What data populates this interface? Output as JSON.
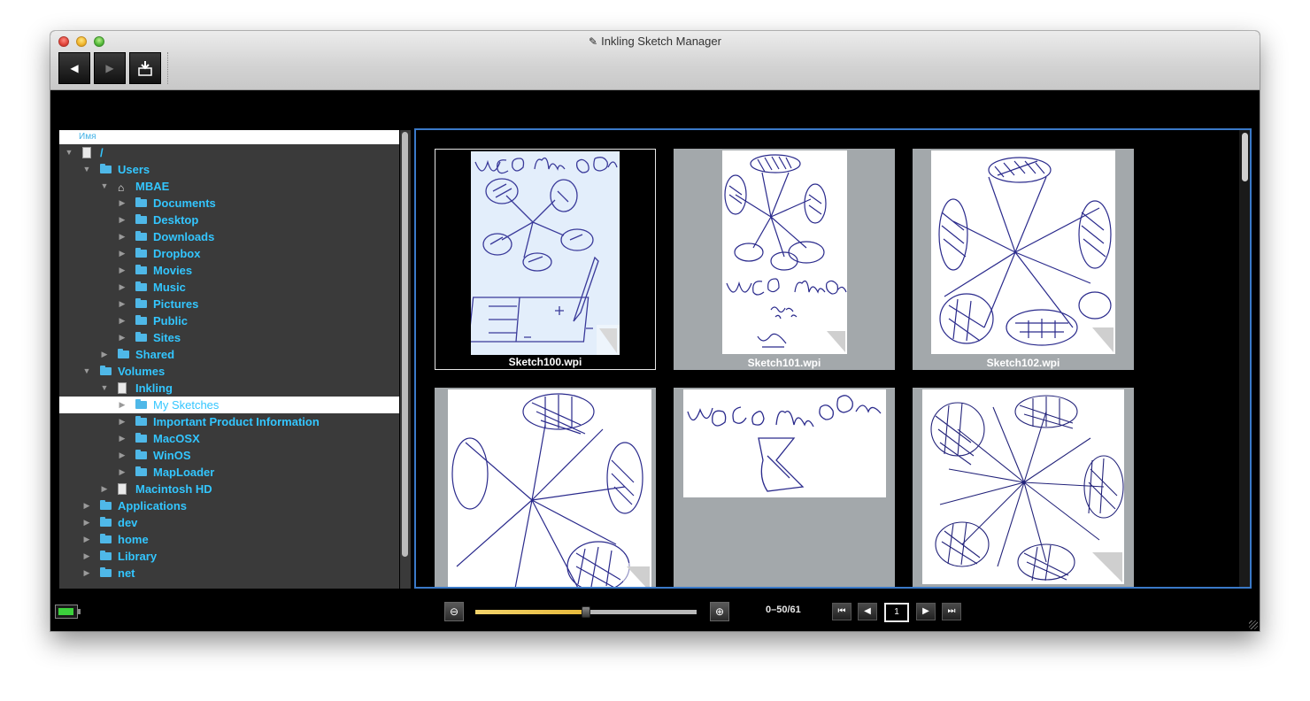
{
  "window": {
    "title": "Inkling Sketch Manager"
  },
  "toolbar": {
    "back_icon": "◀",
    "forward_icon": "▶",
    "export_icon": "⎙"
  },
  "tree": {
    "column_header": "Имя",
    "items": [
      {
        "label": "/",
        "depth": 0,
        "expanded": true,
        "icon": "disk"
      },
      {
        "label": "Users",
        "depth": 1,
        "expanded": true,
        "icon": "folder"
      },
      {
        "label": "MBAE",
        "depth": 2,
        "expanded": true,
        "icon": "home"
      },
      {
        "label": "Documents",
        "depth": 3,
        "expanded": false,
        "icon": "folder"
      },
      {
        "label": "Desktop",
        "depth": 3,
        "expanded": false,
        "icon": "folder"
      },
      {
        "label": "Downloads",
        "depth": 3,
        "expanded": false,
        "icon": "folder"
      },
      {
        "label": "Dropbox",
        "depth": 3,
        "expanded": false,
        "icon": "folder"
      },
      {
        "label": "Movies",
        "depth": 3,
        "expanded": false,
        "icon": "folder"
      },
      {
        "label": "Music",
        "depth": 3,
        "expanded": false,
        "icon": "folder"
      },
      {
        "label": "Pictures",
        "depth": 3,
        "expanded": false,
        "icon": "folder"
      },
      {
        "label": "Public",
        "depth": 3,
        "expanded": false,
        "icon": "folder"
      },
      {
        "label": "Sites",
        "depth": 3,
        "expanded": false,
        "icon": "folder"
      },
      {
        "label": "Shared",
        "depth": 2,
        "expanded": false,
        "icon": "folder"
      },
      {
        "label": "Volumes",
        "depth": 1,
        "expanded": true,
        "icon": "folder"
      },
      {
        "label": "Inkling",
        "depth": 2,
        "expanded": true,
        "icon": "drive"
      },
      {
        "label": "My Sketches",
        "depth": 3,
        "expanded": false,
        "icon": "folder",
        "selected": true
      },
      {
        "label": "Important Product Information",
        "depth": 3,
        "expanded": false,
        "icon": "folder"
      },
      {
        "label": "MacOSX",
        "depth": 3,
        "expanded": false,
        "icon": "folder"
      },
      {
        "label": "WinOS",
        "depth": 3,
        "expanded": false,
        "icon": "folder"
      },
      {
        "label": "MapLoader",
        "depth": 3,
        "expanded": false,
        "icon": "folder"
      },
      {
        "label": "Macintosh HD",
        "depth": 2,
        "expanded": false,
        "icon": "disk"
      },
      {
        "label": "Applications",
        "depth": 1,
        "expanded": false,
        "icon": "folder"
      },
      {
        "label": "dev",
        "depth": 1,
        "expanded": false,
        "icon": "folder"
      },
      {
        "label": "home",
        "depth": 1,
        "expanded": false,
        "icon": "folder"
      },
      {
        "label": "Library",
        "depth": 1,
        "expanded": false,
        "icon": "folder"
      },
      {
        "label": "net",
        "depth": 1,
        "expanded": false,
        "icon": "folder"
      }
    ]
  },
  "gallery": {
    "items": [
      {
        "name": "Sketch100.wpi",
        "selected": true
      },
      {
        "name": "Sketch101.wpi",
        "selected": false
      },
      {
        "name": "Sketch102.wpi",
        "selected": false
      },
      {
        "name": "",
        "selected": false
      },
      {
        "name": "",
        "selected": false
      },
      {
        "name": "",
        "selected": false
      }
    ]
  },
  "status": {
    "zoom_out_icon": "⊖",
    "zoom_in_icon": "⊕",
    "zoom_level": 0.5,
    "range": "0–50/61",
    "first_icon": "⏮",
    "prev_icon": "◀",
    "page": "1",
    "next_icon": "▶",
    "last_icon": "⏭"
  },
  "colors": {
    "accent": "#33c6ff",
    "selection_border": "#3a79c8",
    "ink": "#2a2a8c"
  }
}
